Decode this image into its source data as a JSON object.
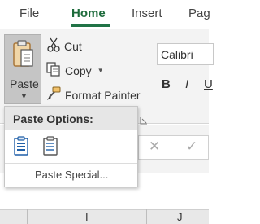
{
  "tabs": [
    {
      "label": "File",
      "active": false
    },
    {
      "label": "Home",
      "active": true
    },
    {
      "label": "Insert",
      "active": false
    },
    {
      "label": "Pag",
      "active": false
    }
  ],
  "clipboard": {
    "paste_label": "Paste",
    "cut_label": "Cut",
    "copy_label": "Copy",
    "format_painter_label": "Format Painter"
  },
  "font": {
    "name": "Calibri",
    "bold": "B",
    "italic": "I",
    "underline": "U"
  },
  "paste_menu": {
    "title": "Paste Options:",
    "options": [
      {
        "icon": "paste-icon"
      },
      {
        "icon": "paste-values-icon"
      }
    ],
    "paste_special_label": "Paste Special..."
  },
  "columns": [
    "I",
    "J"
  ],
  "colors": {
    "accent": "#217346",
    "ribbon": "#f3f3f3",
    "paste_highlight": "#c5c5c5"
  }
}
